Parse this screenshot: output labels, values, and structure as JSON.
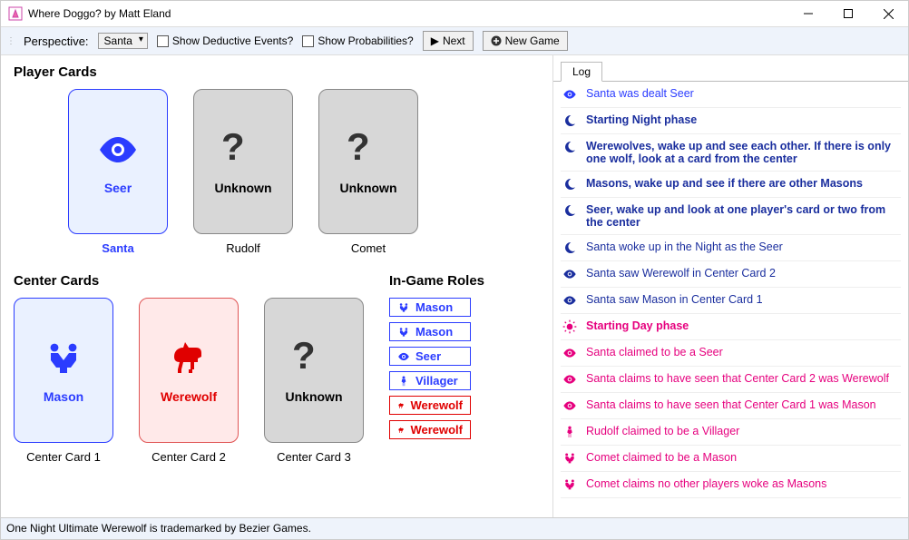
{
  "window": {
    "title": "Where Doggo? by Matt Eland"
  },
  "toolbar": {
    "perspective_label": "Perspective:",
    "perspective_value": "Santa",
    "show_deductive": "Show Deductive Events?",
    "show_probabilities": "Show Probabilities?",
    "next": "Next",
    "new_game": "New Game"
  },
  "sections": {
    "player_cards": "Player Cards",
    "center_cards": "Center Cards",
    "roles": "In-Game Roles"
  },
  "player_cards": [
    {
      "role": "Seer",
      "name": "Santa",
      "icon": "eye",
      "known": true,
      "color": "blue",
      "bold": true
    },
    {
      "role": "Unknown",
      "name": "Rudolf",
      "icon": "question",
      "known": false
    },
    {
      "role": "Unknown",
      "name": "Comet",
      "icon": "question",
      "known": false
    }
  ],
  "center_cards": [
    {
      "role": "Mason",
      "name": "Center Card 1",
      "icon": "mason",
      "known": true,
      "color": "blue"
    },
    {
      "role": "Werewolf",
      "name": "Center Card 2",
      "icon": "wolf",
      "known": true,
      "color": "red"
    },
    {
      "role": "Unknown",
      "name": "Center Card 3",
      "icon": "question",
      "known": false
    }
  ],
  "roles": [
    {
      "label": "Mason",
      "icon": "mason",
      "color": "blue"
    },
    {
      "label": "Mason",
      "icon": "mason",
      "color": "blue"
    },
    {
      "label": "Seer",
      "icon": "eye",
      "color": "blue"
    },
    {
      "label": "Villager",
      "icon": "person",
      "color": "blue"
    },
    {
      "label": "Werewolf",
      "icon": "wolf",
      "color": "red"
    },
    {
      "label": "Werewolf",
      "icon": "wolf",
      "color": "red"
    }
  ],
  "tabs": {
    "log": "Log"
  },
  "log": [
    {
      "icon": "eye",
      "color": "blue",
      "bold": false,
      "text": "Santa was dealt Seer"
    },
    {
      "icon": "moon",
      "color": "navy",
      "bold": true,
      "text": "Starting Night phase"
    },
    {
      "icon": "moon",
      "color": "navy",
      "bold": true,
      "text": "Werewolves, wake up and see each other. If there is only one wolf, look at a card from the center"
    },
    {
      "icon": "moon",
      "color": "navy",
      "bold": true,
      "text": "Masons, wake up and see if there are other Masons"
    },
    {
      "icon": "moon",
      "color": "navy",
      "bold": true,
      "text": "Seer, wake up and look at one player's card or two from the center"
    },
    {
      "icon": "moon",
      "color": "navy",
      "bold": false,
      "text": "Santa woke up in the Night as the Seer"
    },
    {
      "icon": "eye",
      "color": "navy",
      "bold": false,
      "text": "Santa saw Werewolf in Center Card 2"
    },
    {
      "icon": "eye",
      "color": "navy",
      "bold": false,
      "text": "Santa saw Mason in Center Card 1"
    },
    {
      "icon": "sun",
      "color": "pink",
      "bold": true,
      "text": "Starting Day phase"
    },
    {
      "icon": "eye",
      "color": "pink",
      "bold": false,
      "text": "Santa claimed to be a Seer"
    },
    {
      "icon": "eye",
      "color": "pink",
      "bold": false,
      "text": "Santa claims to have seen that Center Card 2 was Werewolf"
    },
    {
      "icon": "eye",
      "color": "pink",
      "bold": false,
      "text": "Santa claims to have seen that Center Card 1 was Mason"
    },
    {
      "icon": "person",
      "color": "pink",
      "bold": false,
      "text": "Rudolf claimed to be a Villager"
    },
    {
      "icon": "mason",
      "color": "pink",
      "bold": false,
      "text": "Comet claimed to be a Mason"
    },
    {
      "icon": "mason",
      "color": "pink",
      "bold": false,
      "text": "Comet claims no other players woke as Masons"
    }
  ],
  "footer": "One Night Ultimate Werewolf is trademarked by Bezier Games."
}
